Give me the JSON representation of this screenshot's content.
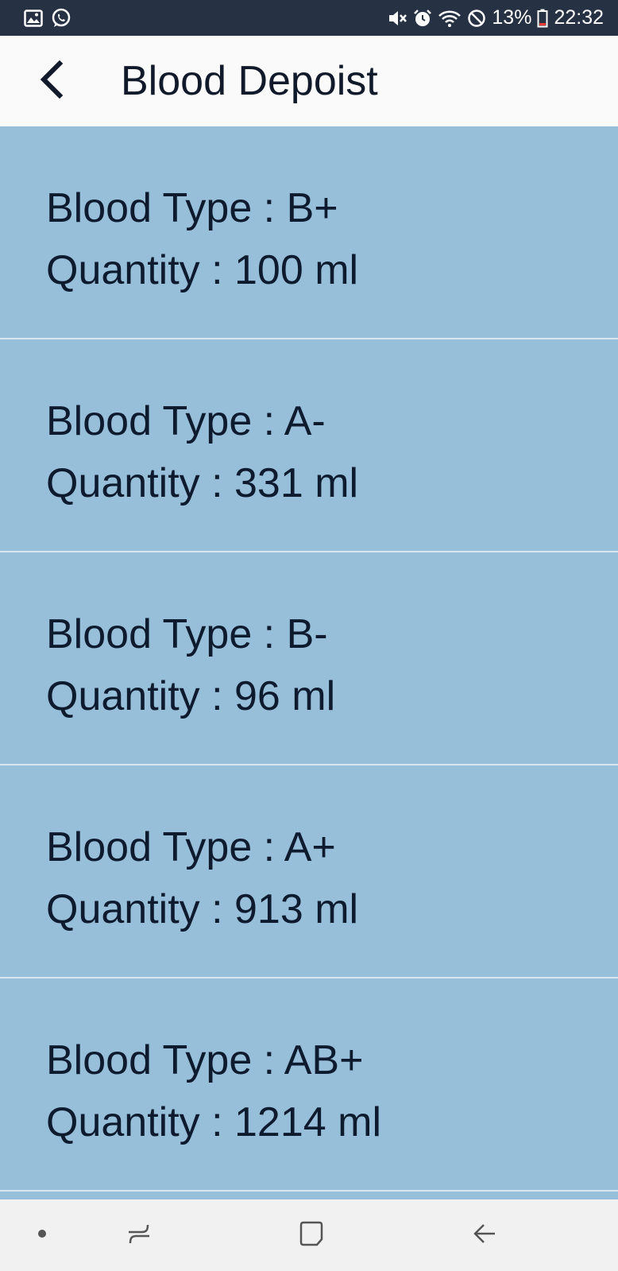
{
  "status_bar": {
    "battery_percent": "13%",
    "time": "22:32",
    "left_icons": [
      "gallery-icon",
      "whatsapp-icon"
    ],
    "right_icons": [
      "mute-icon",
      "alarm-icon",
      "wifi-icon",
      "do-not-disturb-icon",
      "battery-icon"
    ]
  },
  "app_bar": {
    "title": "Blood Depoist",
    "back_icon": "chevron-left-icon"
  },
  "deposits": [
    {
      "type_line": "Blood Type : B+",
      "quantity_line": "Quantity : 100 ml"
    },
    {
      "type_line": "Blood Type : A-",
      "quantity_line": "Quantity : 331 ml"
    },
    {
      "type_line": "Blood Type : B-",
      "quantity_line": "Quantity : 96 ml"
    },
    {
      "type_line": "Blood Type : A+",
      "quantity_line": "Quantity : 913 ml"
    },
    {
      "type_line": "Blood Type : AB+",
      "quantity_line": "Quantity : 1214 ml"
    }
  ],
  "nav_bar": {
    "icons": [
      "dot-icon",
      "recent-apps-icon",
      "home-icon",
      "back-icon"
    ]
  },
  "colors": {
    "status_bar": "#263244",
    "app_bar": "#fafafa",
    "list_background": "#98bfd9",
    "divider": "#d6e5ef",
    "text": "#0e1a2e",
    "nav_bar": "#f1f1f1"
  }
}
